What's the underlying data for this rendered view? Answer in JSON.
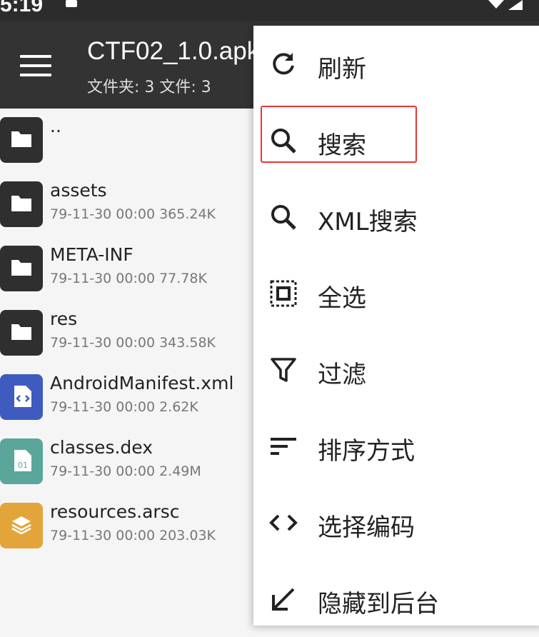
{
  "status_bar": {
    "time": "5:19",
    "icons": [
      "notification-icon",
      "wifi-icon",
      "signal-icon"
    ]
  },
  "app_bar": {
    "title": "CTF02_1.0.apk",
    "subtitle": "文件夹: 3  文件: 3"
  },
  "files": [
    {
      "name": "..",
      "meta": "",
      "icon": "folder-icon",
      "color": "#2f2f2f"
    },
    {
      "name": "assets",
      "meta": "79-11-30 00:00  365.24K",
      "icon": "folder-icon",
      "color": "#2f2f2f"
    },
    {
      "name": "META-INF",
      "meta": "79-11-30 00:00  77.78K",
      "icon": "folder-icon",
      "color": "#2f2f2f"
    },
    {
      "name": "res",
      "meta": "79-11-30 00:00  343.58K",
      "icon": "folder-icon",
      "color": "#2f2f2f"
    },
    {
      "name": "AndroidManifest.xml",
      "meta": "79-11-30 00:00  2.62K",
      "icon": "xml-file-icon",
      "color": "#3f5bbf"
    },
    {
      "name": "classes.dex",
      "meta": "79-11-30 00:00  2.49M",
      "icon": "dex-file-icon",
      "color": "#5aa69a"
    },
    {
      "name": "resources.arsc",
      "meta": "79-11-30 00:00  203.03K",
      "icon": "arsc-file-icon",
      "color": "#e3a53a"
    }
  ],
  "menu": {
    "items": [
      {
        "label": "刷新",
        "icon": "refresh-icon"
      },
      {
        "label": "搜索",
        "icon": "search-icon"
      },
      {
        "label": "XML搜索",
        "icon": "search-icon"
      },
      {
        "label": "全选",
        "icon": "select-all-icon"
      },
      {
        "label": "过滤",
        "icon": "filter-icon"
      },
      {
        "label": "排序方式",
        "icon": "sort-icon"
      },
      {
        "label": "选择编码",
        "icon": "code-icon"
      },
      {
        "label": "隐藏到后台",
        "icon": "arrow-down-left-icon"
      }
    ],
    "highlighted_item": "搜索",
    "highlight_color": "#e53935"
  }
}
